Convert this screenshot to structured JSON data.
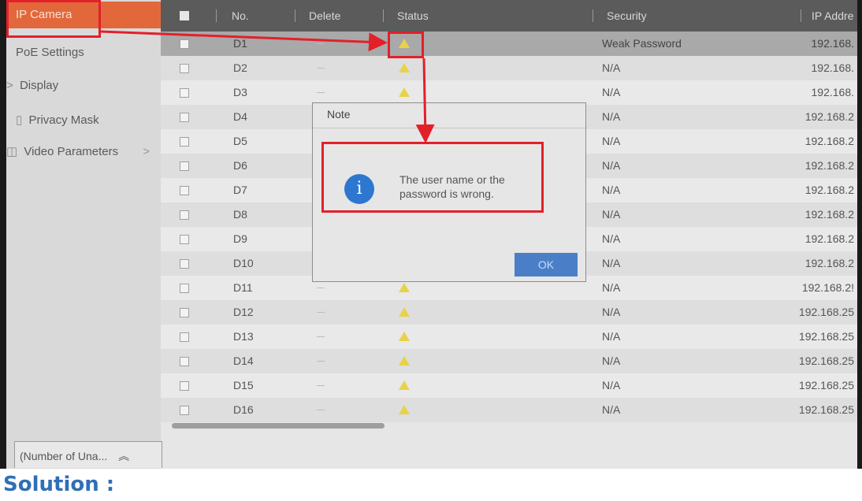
{
  "sidebar": {
    "items": [
      {
        "label": "IP Camera",
        "active": true
      },
      {
        "label": "PoE Settings",
        "prefix": ""
      },
      {
        "label": "Display",
        "prefix": ">"
      },
      {
        "label": "Privacy Mask",
        "prefix": ""
      },
      {
        "label": "Video Parameters",
        "prefix": "",
        "suffix": ">"
      }
    ]
  },
  "table": {
    "headers": {
      "no": "No.",
      "delete": "Delete",
      "status": "Status",
      "security": "Security",
      "ip": "IP Addre"
    },
    "rows": [
      {
        "no": "D1",
        "security": "Weak Password",
        "ip": "192.168."
      },
      {
        "no": "D2",
        "security": "N/A",
        "ip": "192.168."
      },
      {
        "no": "D3",
        "security": "N/A",
        "ip": "192.168."
      },
      {
        "no": "D4",
        "security": "N/A",
        "ip": "192.168.2"
      },
      {
        "no": "D5",
        "security": "N/A",
        "ip": "192.168.2"
      },
      {
        "no": "D6",
        "security": "N/A",
        "ip": "192.168.2"
      },
      {
        "no": "D7",
        "security": "N/A",
        "ip": "192.168.2"
      },
      {
        "no": "D8",
        "security": "N/A",
        "ip": "192.168.2"
      },
      {
        "no": "D9",
        "security": "N/A",
        "ip": "192.168.2"
      },
      {
        "no": "D10",
        "security": "N/A",
        "ip": "192.168.2"
      },
      {
        "no": "D11",
        "security": "N/A",
        "ip": "192.168.2!"
      },
      {
        "no": "D12",
        "security": "N/A",
        "ip": "192.168.25"
      },
      {
        "no": "D13",
        "security": "N/A",
        "ip": "192.168.25"
      },
      {
        "no": "D14",
        "security": "N/A",
        "ip": "192.168.25"
      },
      {
        "no": "D15",
        "security": "N/A",
        "ip": "192.168.25"
      },
      {
        "no": "D16",
        "security": "N/A",
        "ip": "192.168.25"
      }
    ]
  },
  "bottom_tab": {
    "label": "(Number of Una...",
    "icon": "double-chevron-up-icon"
  },
  "dialog": {
    "title": "Note",
    "message_line1": "The user name or the",
    "message_line2": "password is wrong.",
    "ok_label": "OK",
    "icon": "info-icon"
  },
  "footer": {
    "solution_label": "Solution :"
  },
  "colors": {
    "active_tab": "#e2683b",
    "annotation_red": "#e2202a",
    "info_blue": "#2d77d1",
    "solution_blue": "#2f6fb6",
    "warning_yellow": "#e8d24a"
  }
}
